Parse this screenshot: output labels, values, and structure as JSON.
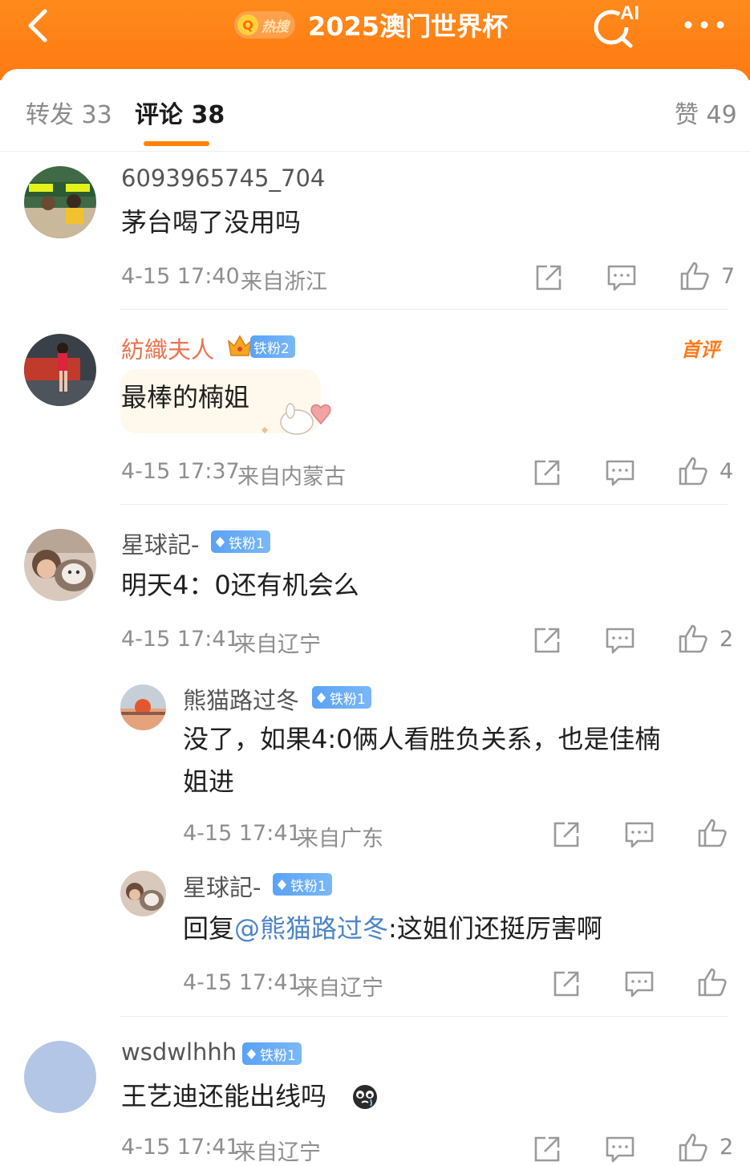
{
  "header": {
    "hot_label": "热搜",
    "topic": "2025澳门世界杯",
    "ai_label": "AI"
  },
  "tabs": {
    "reposts": "转发 33",
    "comments": "评论 38",
    "likes": "赞 49"
  },
  "colors": {
    "accent": "#ff8200",
    "mention": "#4d84c6",
    "vip_name": "#eb7350"
  },
  "comments": [
    {
      "user": "6093965745_704",
      "text": "茅台喝了没用吗",
      "time": "4-15 17:40",
      "location": "来自浙江",
      "likes": "7"
    },
    {
      "user": "紡織夫人",
      "badge": "铁粉2",
      "tag": "首评",
      "text": "最棒的楠姐",
      "time": "4-15 17:37",
      "location": "来自内蒙古",
      "likes": "4"
    },
    {
      "user": "星球記-",
      "badge": "铁粉1",
      "text": "明天4：0还有机会么",
      "time": "4-15 17:41",
      "location": "来自辽宁",
      "likes": "2"
    },
    {
      "user": "wsdwlhhh",
      "badge": "铁粉1",
      "text": "王艺迪还能出线吗",
      "time": "4-15 17:41",
      "location": "来自辽宁",
      "likes": "2"
    }
  ],
  "replies": [
    {
      "user": "熊猫路过冬",
      "badge": "铁粉1",
      "text_line1": "没了，如果4:0俩人看胜负关系，也是佳楠",
      "text_line2": "姐进",
      "time": "4-15 17:41",
      "location": "来自广东"
    },
    {
      "user": "星球記-",
      "badge": "铁粉1",
      "reply_prefix": "回复",
      "mention": "@熊猫路过冬",
      "text": ":这姐们还挺厉害啊",
      "time": "4-15 17:41",
      "location": "来自辽宁"
    }
  ]
}
